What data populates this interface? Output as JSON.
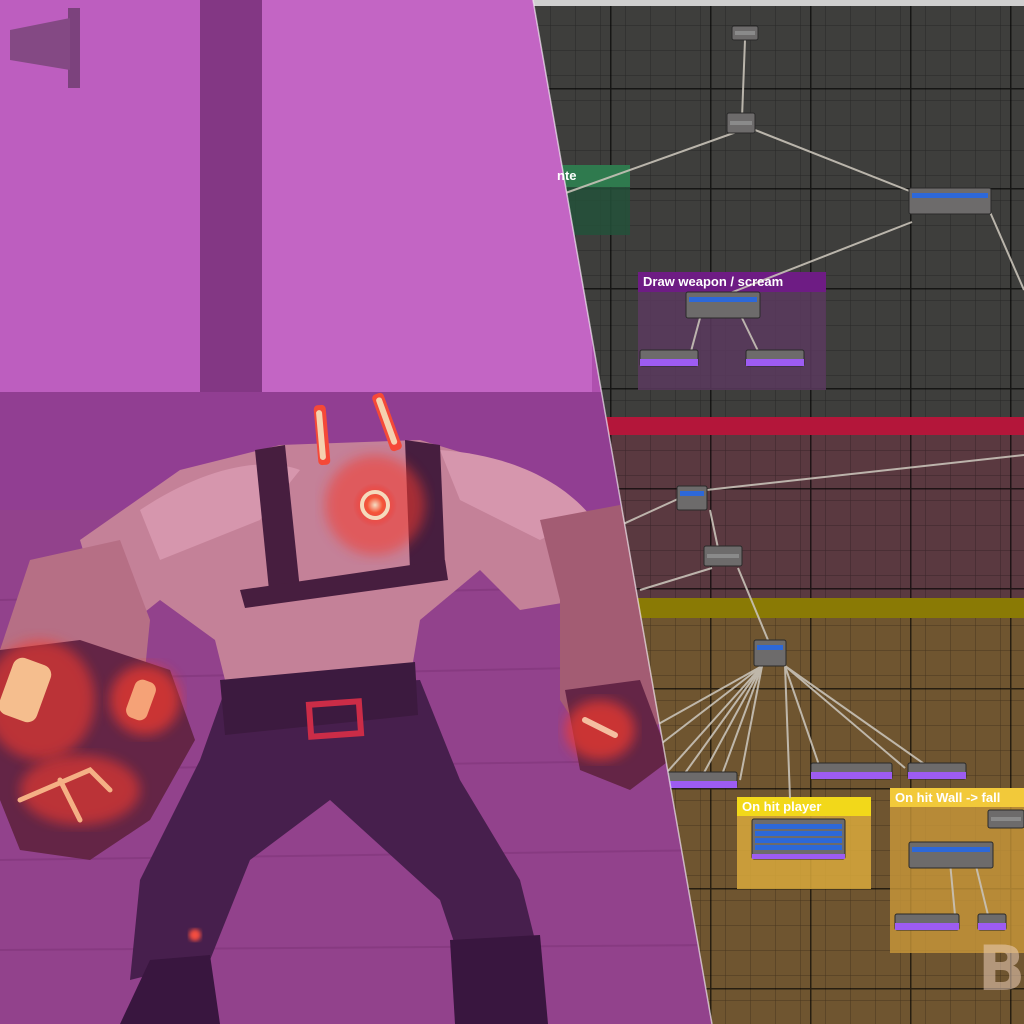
{
  "editor": {
    "comments": {
      "green": {
        "title": "nte",
        "color": "#2f7a4e"
      },
      "purple": {
        "title": "Draw weapon / scream",
        "color": "#6e1c84"
      },
      "yellow_left": {
        "title": "On hit player",
        "color": "#f2d81a"
      },
      "yellow_right": {
        "title": "On hit Wall -> fall",
        "color": "#f2c93a"
      }
    },
    "watermark": "B"
  },
  "colors": {
    "game_scene": "#b052b0",
    "grid_top": "#3e3e3c",
    "grid_mid": "#5a3940",
    "grid_bottom": "#6f5530",
    "section_bar_red": "#b4163a",
    "section_bar_yellow": "#8a7a05",
    "node_blue": "#2d68d8",
    "node_purple": "#9d5cf2",
    "node_body": "#6d6b6b",
    "glow_red": "#ff3b1e"
  },
  "icons": {
    "flag": "flag-icon"
  }
}
